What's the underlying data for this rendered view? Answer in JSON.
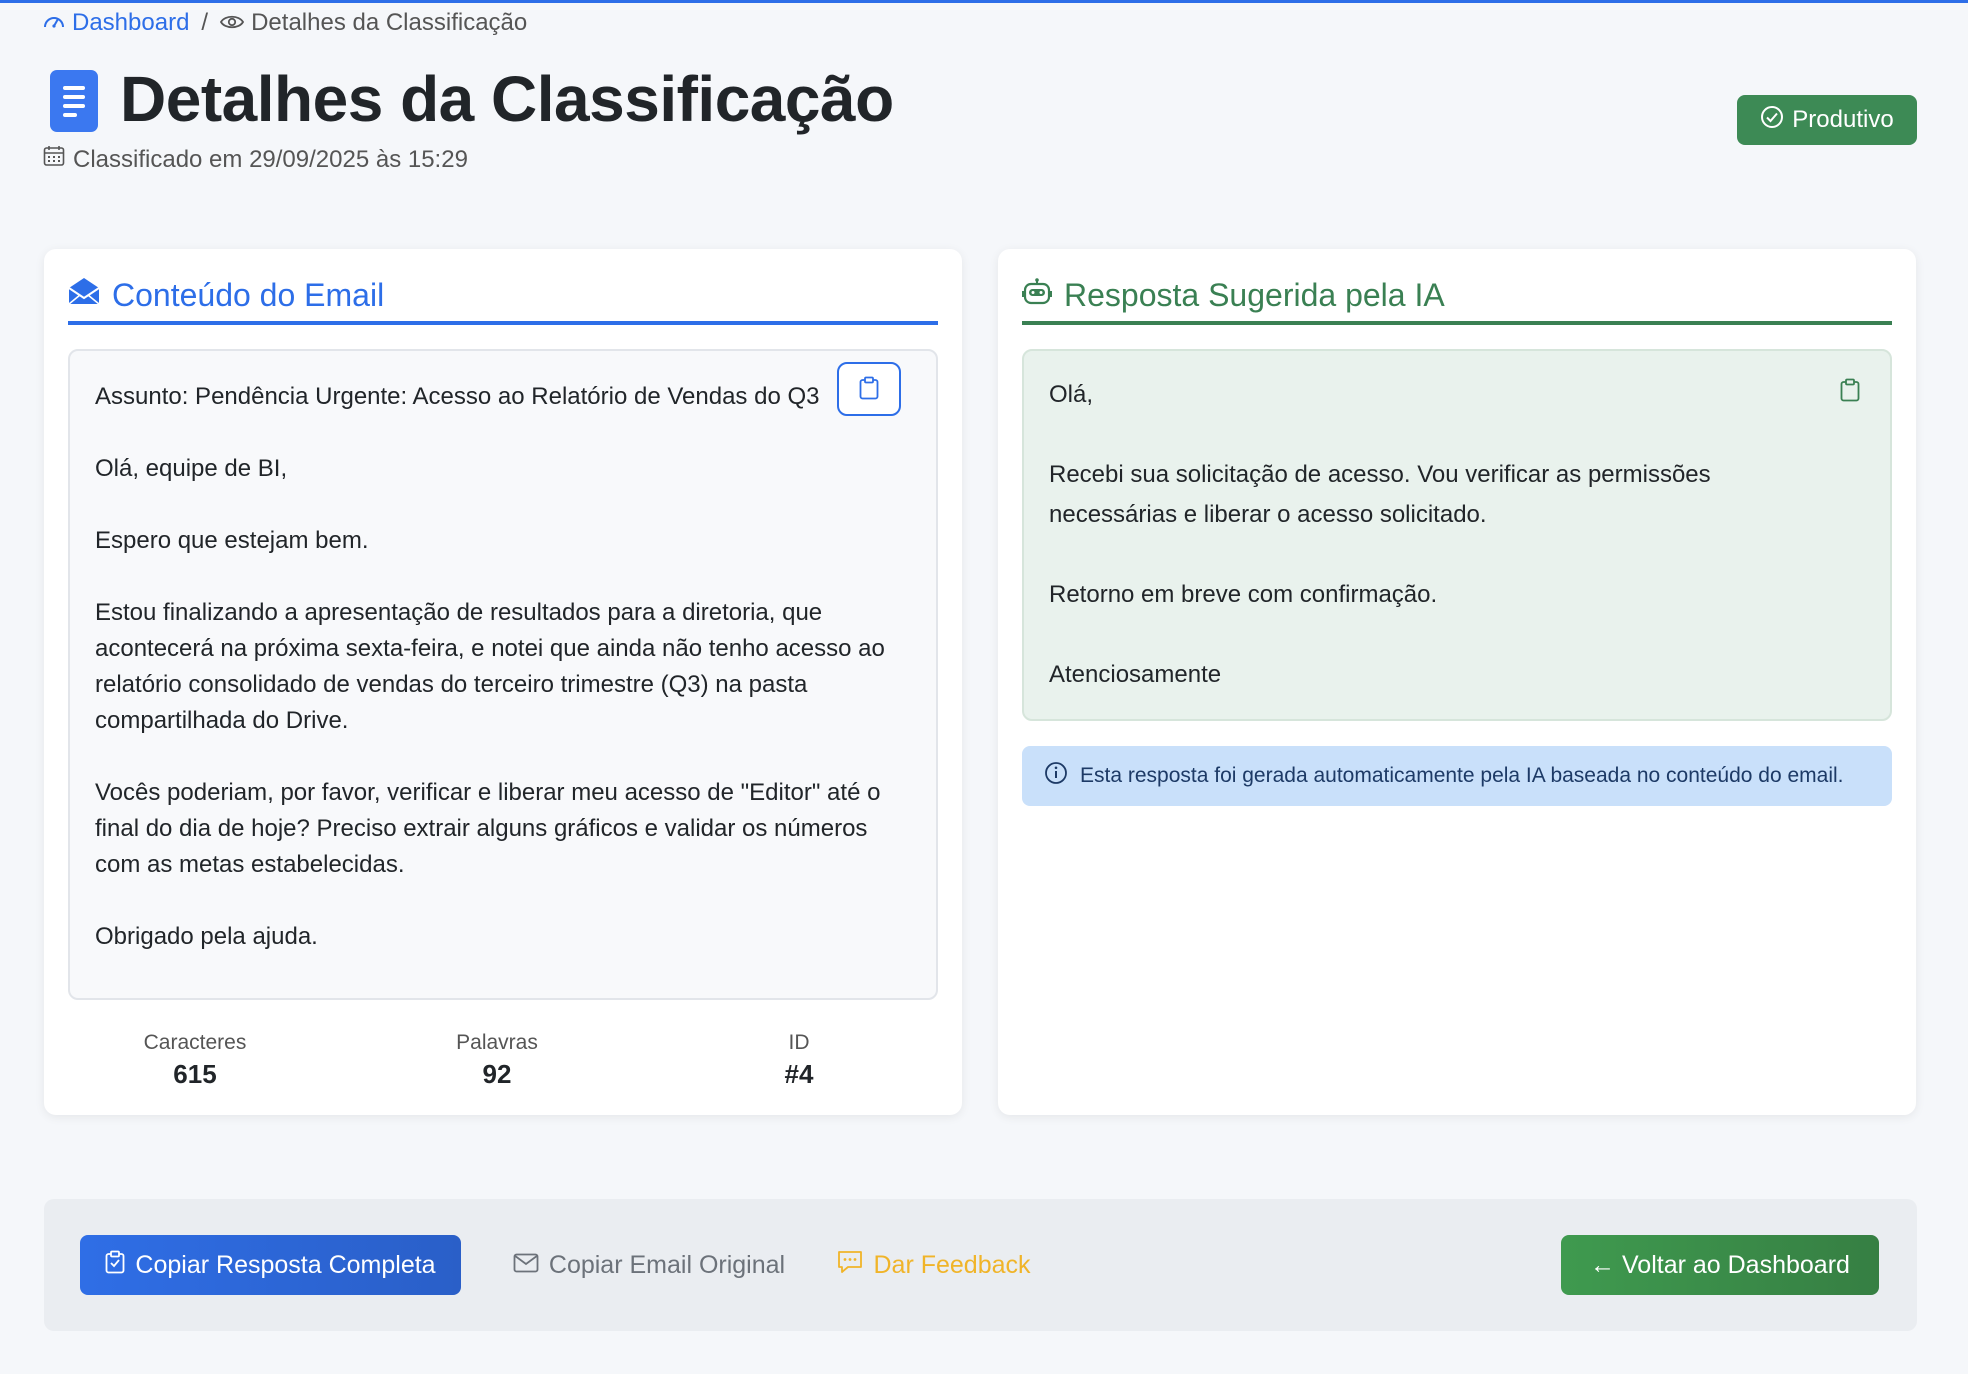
{
  "breadcrumb": {
    "dashboard_label": "Dashboard",
    "separator": "/",
    "current_label": "Detalhes da Classificação"
  },
  "header": {
    "title": "Detalhes da Classificação",
    "subtitle": "Classificado em 29/09/2025 às 15:29",
    "status_badge": "Produtivo"
  },
  "email_card": {
    "title": "Conteúdo do Email",
    "paragraphs": [
      "Assunto: Pendência Urgente: Acesso ao Relatório de Vendas do Q3",
      "Olá, equipe de BI,",
      "Espero que estejam bem.",
      "Estou finalizando a apresentação de resultados para a diretoria, que acontecerá na próxima sexta-feira, e notei que ainda não tenho acesso ao relatório consolidado de vendas do terceiro trimestre (Q3) na pasta compartilhada do Drive.",
      "Vocês poderiam, por favor, verificar e liberar meu acesso de \"Editor\" até o final do dia de hoje? Preciso extrair alguns gráficos e validar os números com as metas estabelecidas.",
      "Obrigado pela ajuda."
    ],
    "stats": [
      {
        "label": "Caracteres",
        "value": "615"
      },
      {
        "label": "Palavras",
        "value": "92"
      },
      {
        "label": "ID",
        "value": "#4"
      }
    ]
  },
  "reply_card": {
    "title": "Resposta Sugerida pela IA",
    "paragraphs": [
      "Olá,",
      "Recebi sua solicitação de acesso. Vou verificar as permissões necessárias e liberar o acesso solicitado.",
      "Retorno em breve com confirmação.",
      "Atenciosamente"
    ],
    "info": "Esta resposta foi gerada automaticamente pela IA baseada no conteúdo do email."
  },
  "actions": {
    "copy_reply": "Copiar Resposta Completa",
    "copy_email": "Copiar Email Original",
    "feedback": "Dar Feedback",
    "back": "← Voltar ao Dashboard"
  },
  "colors": {
    "primary": "#2d6ee8",
    "success": "#3d8a55",
    "warning": "#f0b429",
    "info_bg": "#c9e0fa"
  }
}
